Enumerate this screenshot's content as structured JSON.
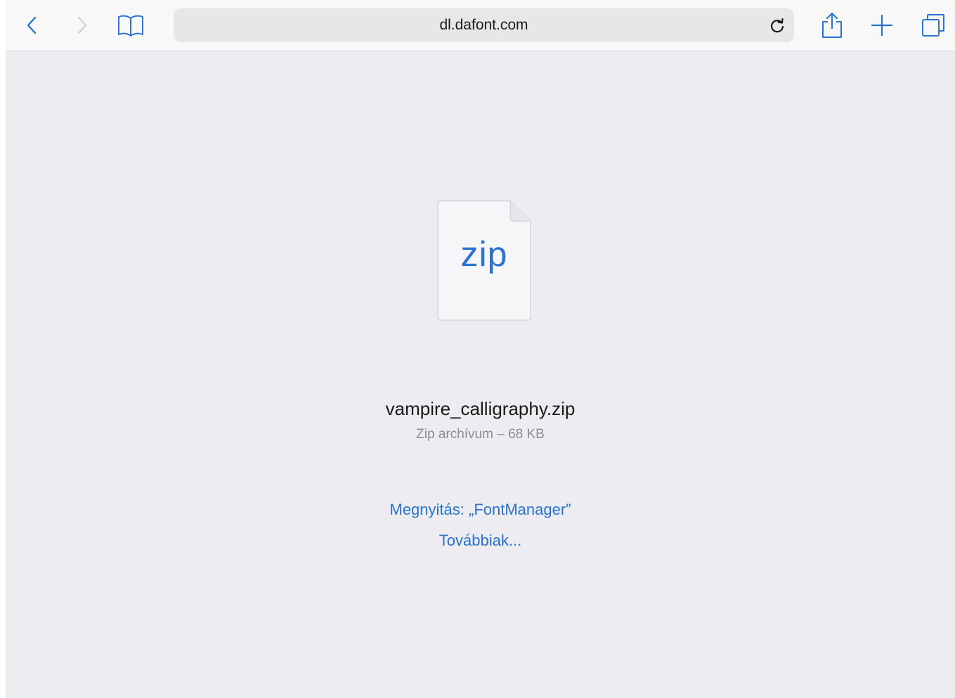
{
  "toolbar": {
    "url": "dl.dafont.com",
    "icons": {
      "back": "chevron-left-icon",
      "forward": "chevron-right-icon",
      "bookmarks": "book-icon",
      "reload": "reload-icon",
      "share": "share-icon",
      "new_tab": "plus-icon",
      "tabs": "tabs-icon"
    }
  },
  "download": {
    "file_icon_label": "zip",
    "file_name": "vampire_calligraphy.zip",
    "file_meta": "Zip archívum – 68 KB",
    "open_in_label": "Megnyitás: „FontManager”",
    "more_label": "Továbbiak..."
  },
  "colors": {
    "accent": "#2a73d2",
    "background": "#ececf1",
    "toolbar": "#f8f8f8",
    "address_bar": "#e7e7ea"
  }
}
